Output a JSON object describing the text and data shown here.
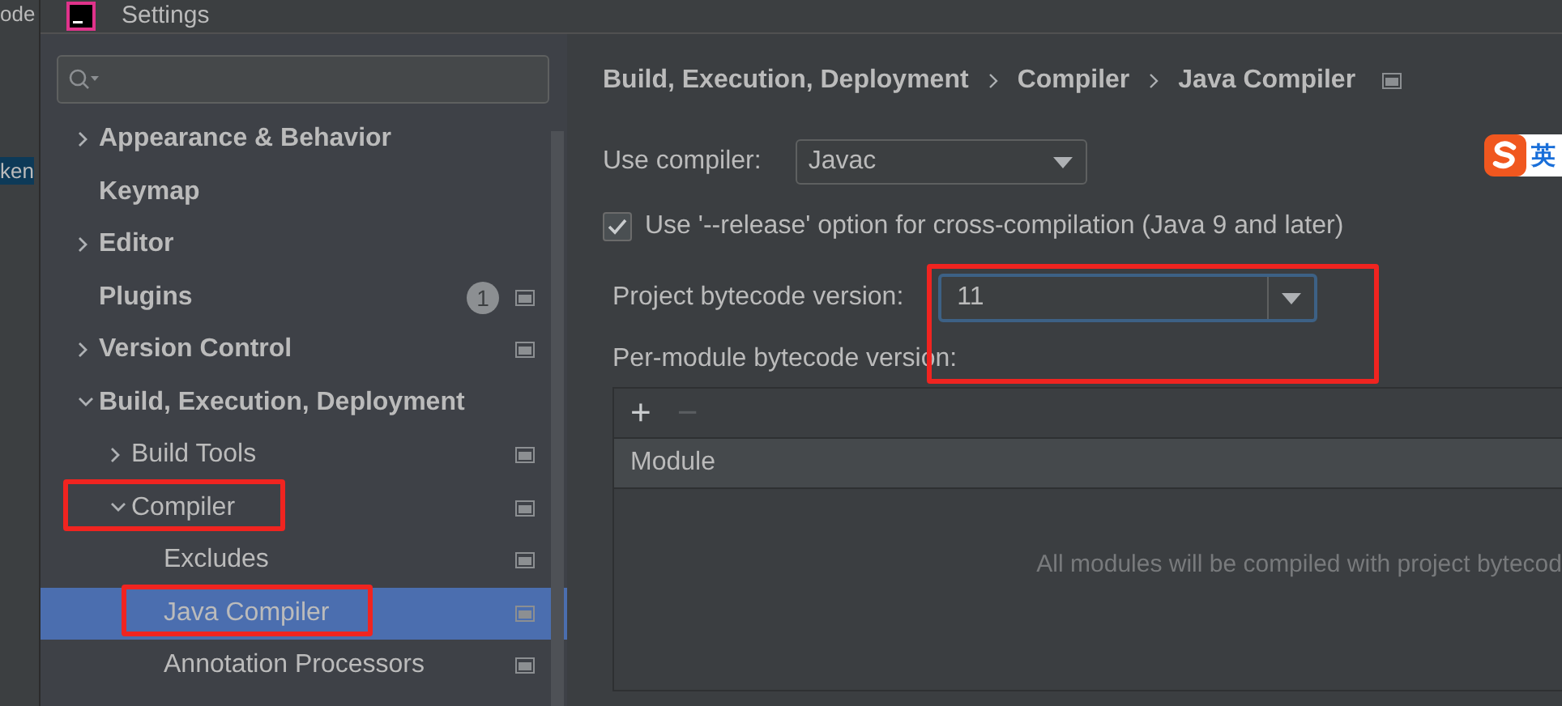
{
  "background_ide": {
    "texts": [
      {
        "text": "ode",
        "highlighted": false
      },
      {
        "text": "ken",
        "highlighted": true
      }
    ]
  },
  "window": {
    "title": "Settings"
  },
  "sidebar": {
    "items": [
      {
        "label": "Appearance & Behavior",
        "expanded": false
      },
      {
        "label": "Keymap"
      },
      {
        "label": "Editor",
        "expanded": false
      },
      {
        "label": "Plugins",
        "badge": "1",
        "project_icon": true
      },
      {
        "label": "Version Control",
        "expanded": false,
        "project_icon": true
      },
      {
        "label": "Build, Execution, Deployment",
        "expanded": true,
        "children": [
          {
            "label": "Build Tools",
            "expanded": false,
            "project_icon": true
          },
          {
            "label": "Compiler",
            "expanded": true,
            "project_icon": true,
            "children": [
              {
                "label": "Excludes",
                "project_icon": true,
                "selected": false
              },
              {
                "label": "Java Compiler",
                "project_icon": true,
                "selected": true
              },
              {
                "label": "Annotation Processors",
                "project_icon": true,
                "selected": false
              }
            ]
          }
        ]
      }
    ]
  },
  "breadcrumb": [
    "Build, Execution, Deployment",
    "Compiler",
    "Java Compiler"
  ],
  "ime_indicator": {
    "text": "英"
  },
  "form": {
    "use_compiler": {
      "label": "Use compiler:",
      "value": "Javac"
    },
    "release_option": {
      "label": "Use '--release' option for cross-compilation (Java 9 and later)",
      "checked": true
    },
    "project_bytecode": {
      "label": "Project bytecode version:",
      "value": "11",
      "focused": true
    },
    "per_module_label": "Per-module bytecode version:",
    "table": {
      "toolbar": [
        {
          "text": "+",
          "disabled": false
        },
        {
          "text": "−",
          "disabled": true
        }
      ],
      "columns": [
        "Module"
      ],
      "empty_text": "All modules will be compiled with project bytecod"
    }
  }
}
